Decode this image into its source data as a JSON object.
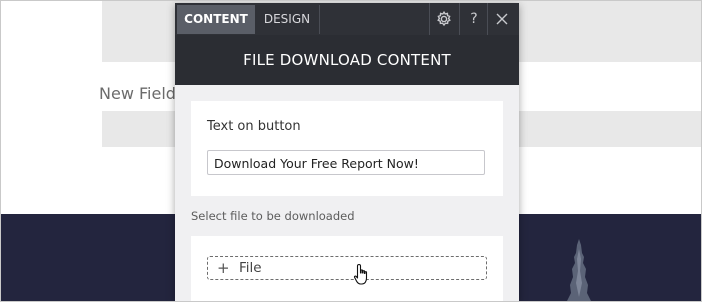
{
  "background": {
    "field_label": "New Field:"
  },
  "panel": {
    "tabs": [
      {
        "label": "CONTENT",
        "active": true
      },
      {
        "label": "DESIGN",
        "active": false
      }
    ],
    "icons": [
      "gear-icon",
      "help-icon",
      "close-icon"
    ],
    "help_glyph": "?",
    "header_title": "FILE DOWNLOAD CONTENT",
    "button_text": {
      "label": "Text on button",
      "value": "Download Your Free Report Now!"
    },
    "file_section": {
      "label": "Select file to be downloaded",
      "button_label": "File"
    }
  },
  "colors": {
    "panel_dark": "#2b2d33",
    "tab_active": "#5a5e67",
    "page_dark": "#23253e"
  }
}
